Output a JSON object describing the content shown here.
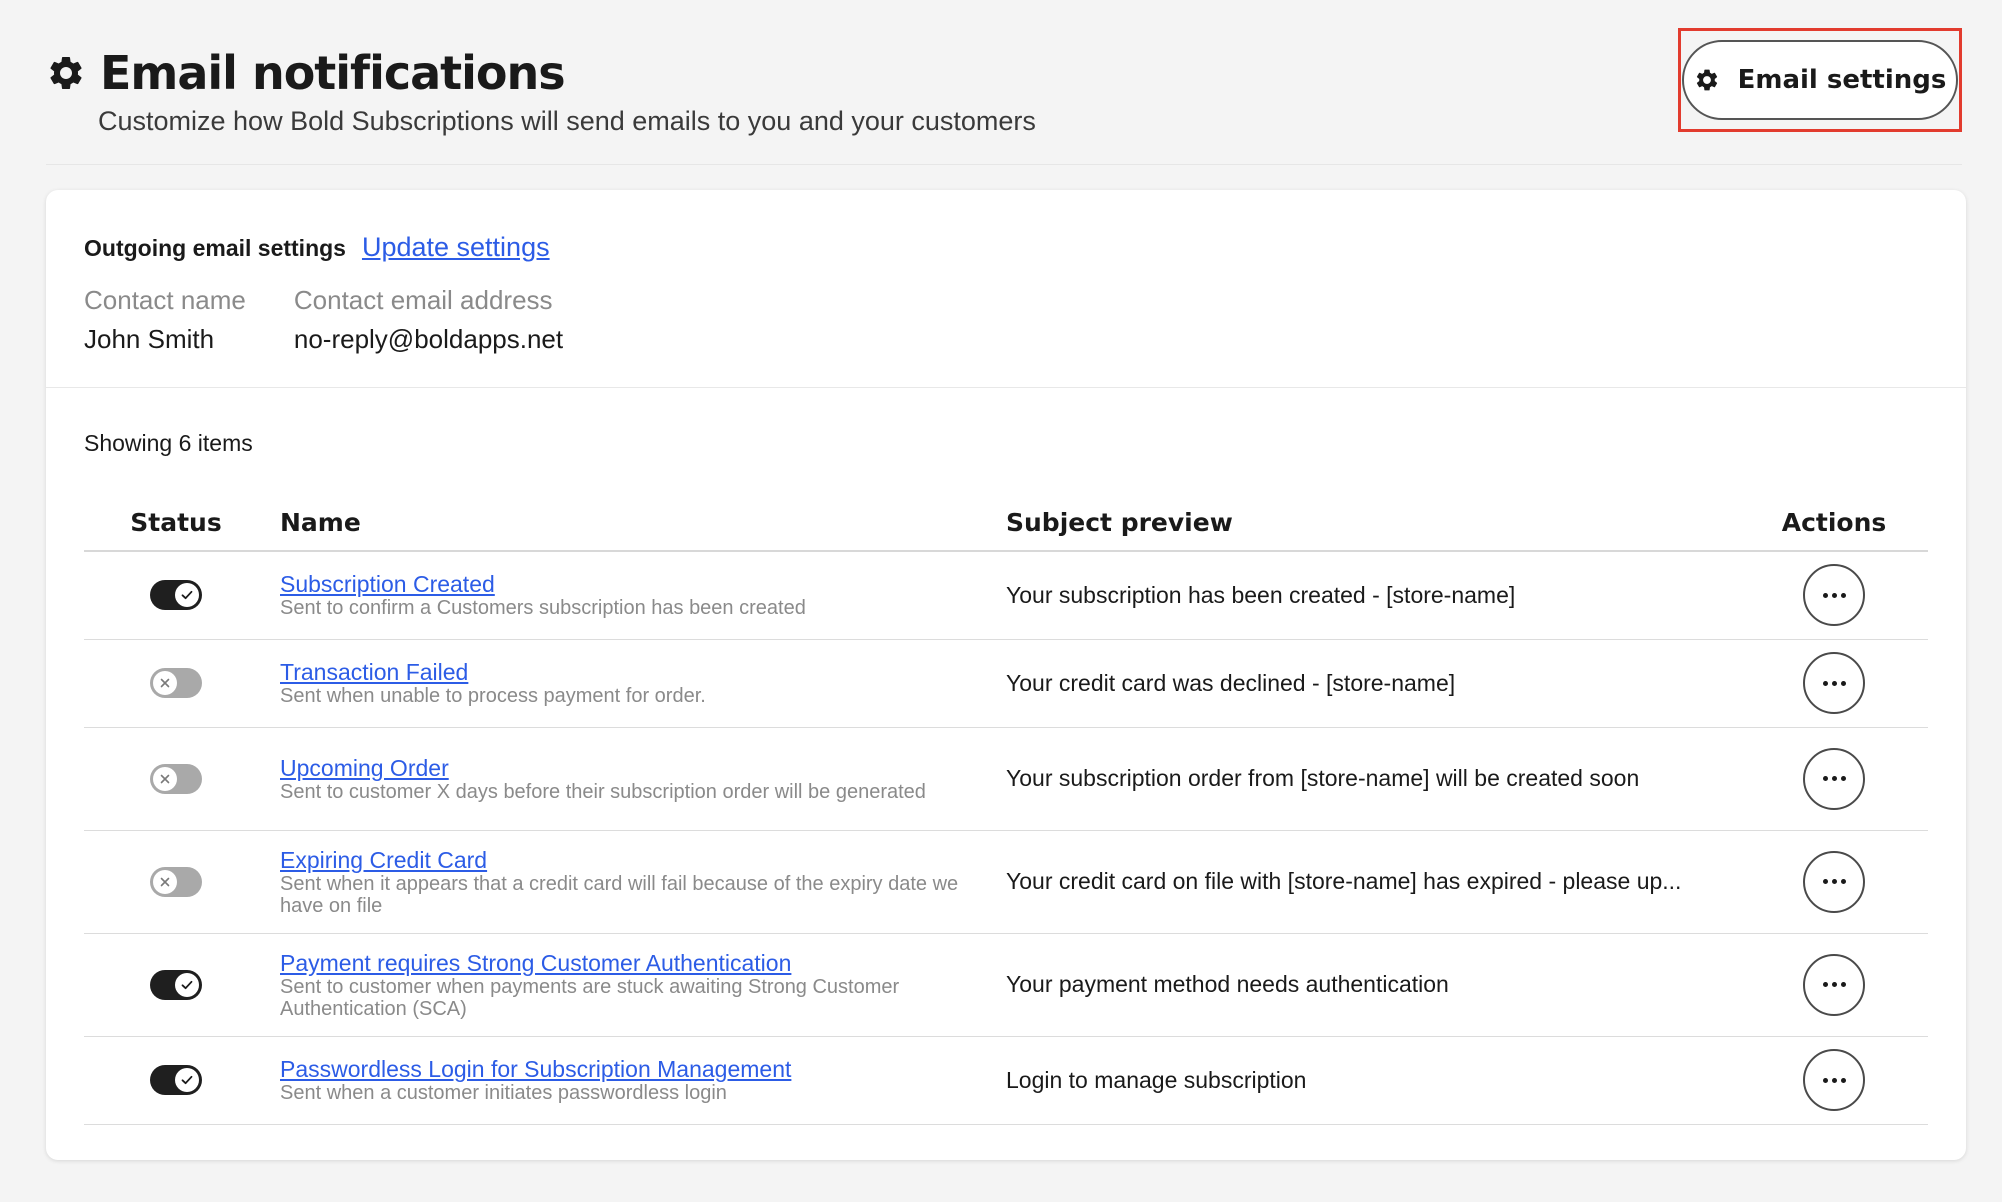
{
  "header": {
    "title": "Email notifications",
    "subtitle": "Customize how Bold Subscriptions will send emails to you and your customers",
    "email_settings_label": "Email settings",
    "icon": "gear-icon"
  },
  "outgoing": {
    "label": "Outgoing email settings",
    "update_link": "Update settings",
    "contact_name_label": "Contact name",
    "contact_name": "John Smith",
    "contact_email_label": "Contact email address",
    "contact_email": "no-reply@boldapps.net"
  },
  "list": {
    "showing": "Showing 6 items",
    "columns": {
      "status": "Status",
      "name": "Name",
      "subject": "Subject preview",
      "actions": "Actions"
    },
    "rows": [
      {
        "enabled": true,
        "name": "Subscription Created",
        "description": "Sent to confirm a Customers subscription has been created",
        "subject": "Your subscription has been created - [store-name]"
      },
      {
        "enabled": false,
        "name": "Transaction Failed",
        "description": "Sent when unable to process payment for order.",
        "subject": "Your credit card was declined - [store-name]"
      },
      {
        "enabled": false,
        "name": "Upcoming Order",
        "description": "Sent to customer X days before their subscription order will be generated",
        "subject": "Your subscription order from [store-name] will be created soon"
      },
      {
        "enabled": false,
        "name": "Expiring Credit Card",
        "description": "Sent when it appears that a credit card will fail because of the expiry date we have on file",
        "subject": "Your credit card on file with [store-name] has expired - please up..."
      },
      {
        "enabled": true,
        "name": "Payment requires Strong Customer Authentication",
        "description": "Sent to customer when payments are stuck awaiting Strong Customer Authentication (SCA)",
        "subject": "Your payment method needs authentication"
      },
      {
        "enabled": true,
        "name": "Passwordless Login for Subscription Management",
        "description": "Sent when a customer initiates passwordless login",
        "subject": "Login to manage subscription"
      }
    ]
  },
  "colors": {
    "accent_link": "#2c5ce6",
    "highlight_box": "#e23b2e",
    "toggle_on": "#1f1f1f",
    "toggle_off": "#a9a9a9"
  }
}
